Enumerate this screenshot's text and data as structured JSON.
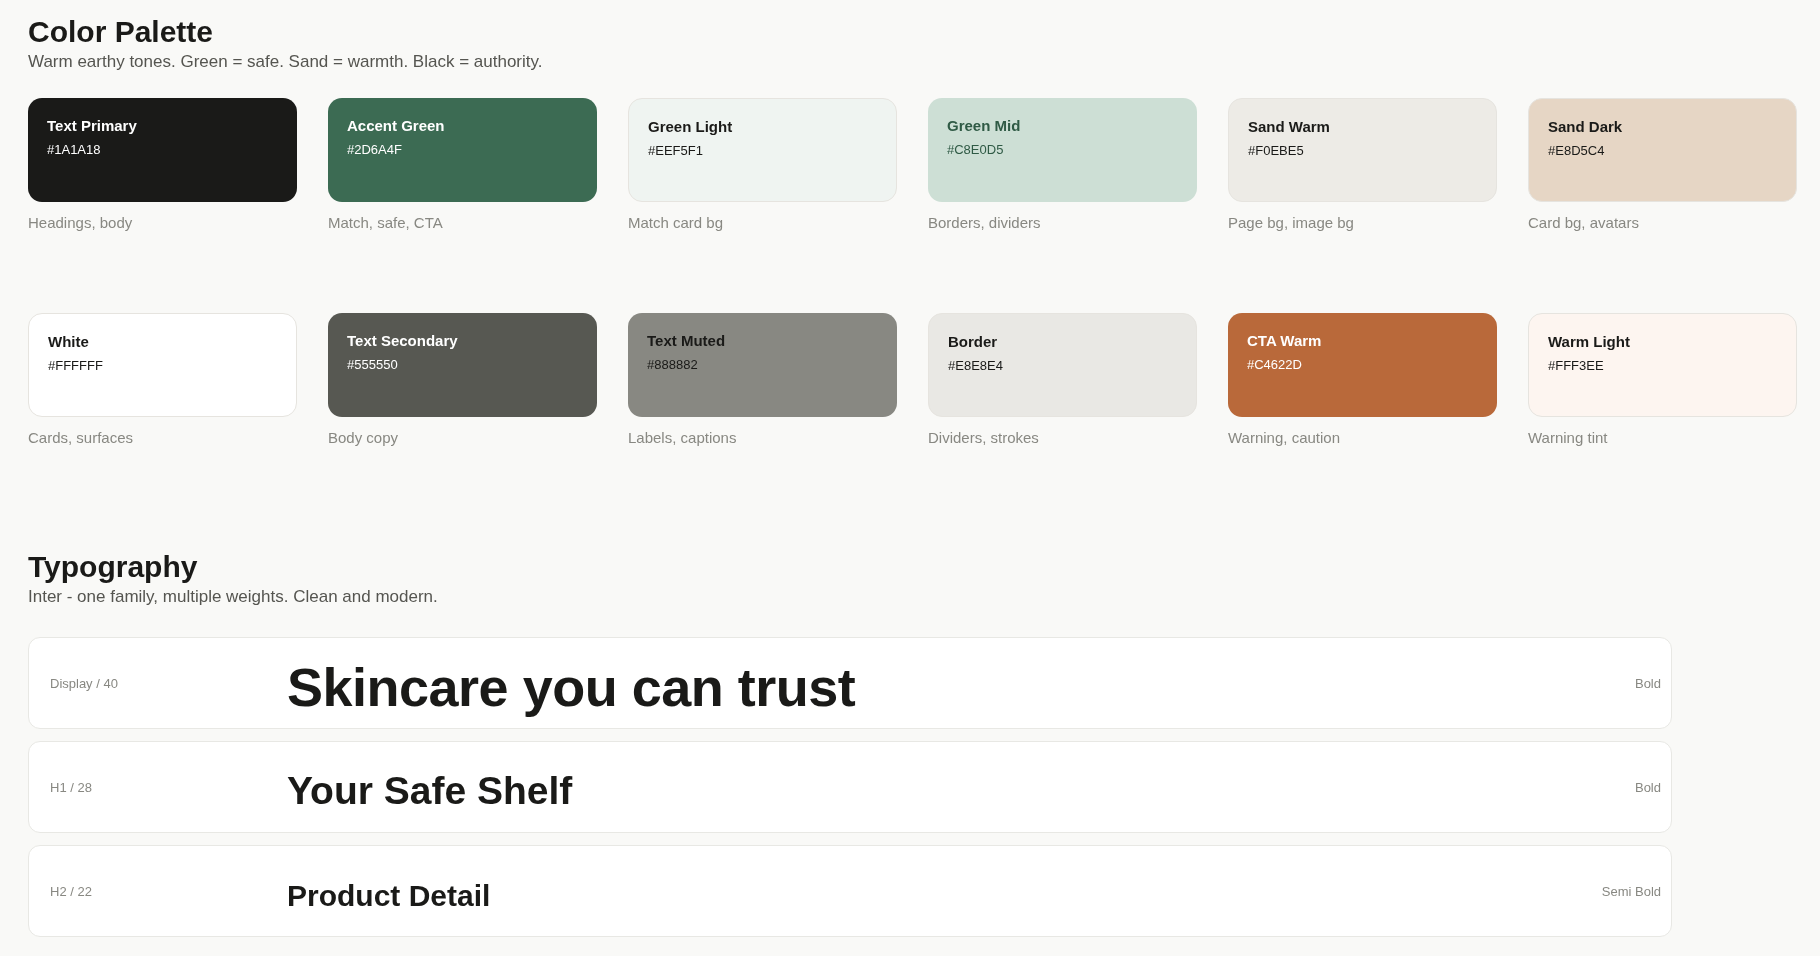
{
  "palette": {
    "title": "Color Palette",
    "subtitle": "Warm earthy tones. Green = safe. Sand = warmth. Black = authority.",
    "swatches": [
      {
        "name": "Text Primary",
        "hex": "#1A1A18",
        "usage": "Headings, body",
        "color": "#1a1a18",
        "kind": "inverse"
      },
      {
        "name": "Accent Green",
        "hex": "#2D6A4F",
        "usage": "Match, safe, CTA",
        "color": "#3c6b53",
        "kind": "inverse"
      },
      {
        "name": "Green Light",
        "hex": "#EEF5F1",
        "usage": "Match card bg",
        "color": "#eff4f1",
        "kind": "outlined"
      },
      {
        "name": "Green Mid",
        "hex": "#C8E0D5",
        "usage": "Borders, dividers",
        "color": "#cddfd5",
        "kind": "soft"
      },
      {
        "name": "Sand Warm",
        "hex": "#F0EBE5",
        "usage": "Page bg, image bg",
        "color": "#edebe6",
        "kind": "outlined"
      },
      {
        "name": "Sand Dark",
        "hex": "#E8D5C4",
        "usage": "Card bg, avatars",
        "color": "#e6d6c5",
        "kind": "outlined"
      },
      {
        "name": "White",
        "hex": "#FFFFFF",
        "usage": "Cards, surfaces",
        "color": "#ffffff",
        "kind": "outlined"
      },
      {
        "name": "Text Secondary",
        "hex": "#555550",
        "usage": "Body copy",
        "color": "#575852",
        "kind": "inverse"
      },
      {
        "name": "Text Muted",
        "hex": "#888882",
        "usage": "Labels, captions",
        "color": "#888882",
        "kind": "plain"
      },
      {
        "name": "Border",
        "hex": "#E8E8E4",
        "usage": "Dividers, strokes",
        "color": "#e9e8e4",
        "kind": "outlined"
      },
      {
        "name": "CTA Warm",
        "hex": "#C4622D",
        "usage": "Warning, caution",
        "color": "#b9693a",
        "kind": "inverse"
      },
      {
        "name": "Warm Light",
        "hex": "#FFF3EE",
        "usage": "Warning tint",
        "color": "#fdf5f0",
        "kind": "outlined"
      }
    ]
  },
  "typography": {
    "title": "Typography",
    "subtitle": "Inter - one family, multiple weights. Clean and modern.",
    "rows": [
      {
        "label": "Display / 40",
        "sample": "Skincare you can trust",
        "weight": "Bold",
        "kind": "display"
      },
      {
        "label": "H1 / 28",
        "sample": "Your Safe Shelf",
        "weight": "Bold",
        "kind": "h1"
      },
      {
        "label": "H2 / 22",
        "sample": "Product Detail",
        "weight": "Semi Bold",
        "kind": "h2"
      }
    ]
  }
}
